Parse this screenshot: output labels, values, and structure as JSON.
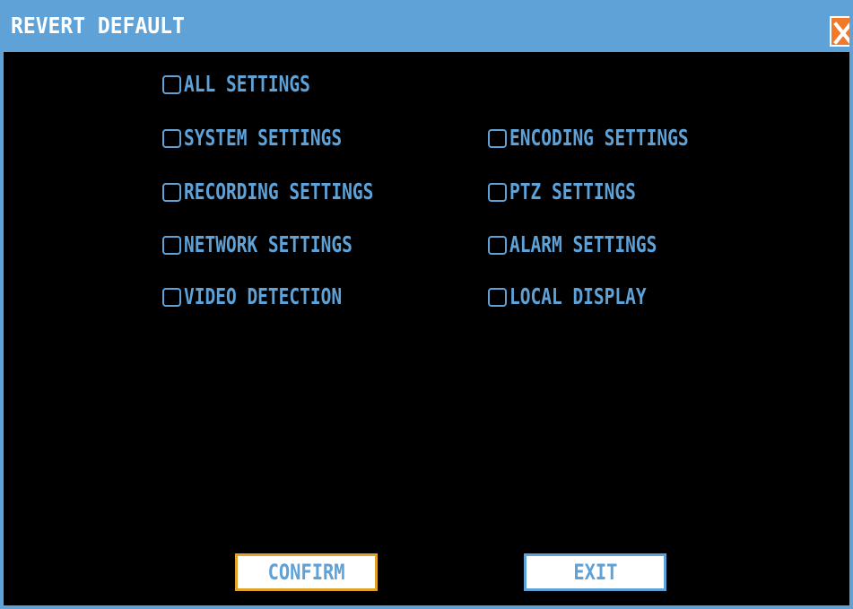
{
  "window": {
    "title": "REVERT DEFAULT",
    "close_icon": "close-icon"
  },
  "options": {
    "all_settings": "ALL SETTINGS",
    "system_settings": "SYSTEM SETTINGS",
    "encoding_settings": "ENCODING SETTINGS",
    "recording_settings": "RECORDING SETTINGS",
    "ptz_settings": "PTZ SETTINGS",
    "network_settings": "NETWORK SETTINGS",
    "alarm_settings": "ALARM SETTINGS",
    "video_detection": "VIDEO DETECTION",
    "local_display": "LOCAL DISPLAY"
  },
  "buttons": {
    "confirm": "CONFIRM",
    "exit": "EXIT"
  },
  "colors": {
    "accent": "#5ea2d8",
    "background": "#000000",
    "focus": "#e0a22a",
    "close": "#f07a2a"
  }
}
